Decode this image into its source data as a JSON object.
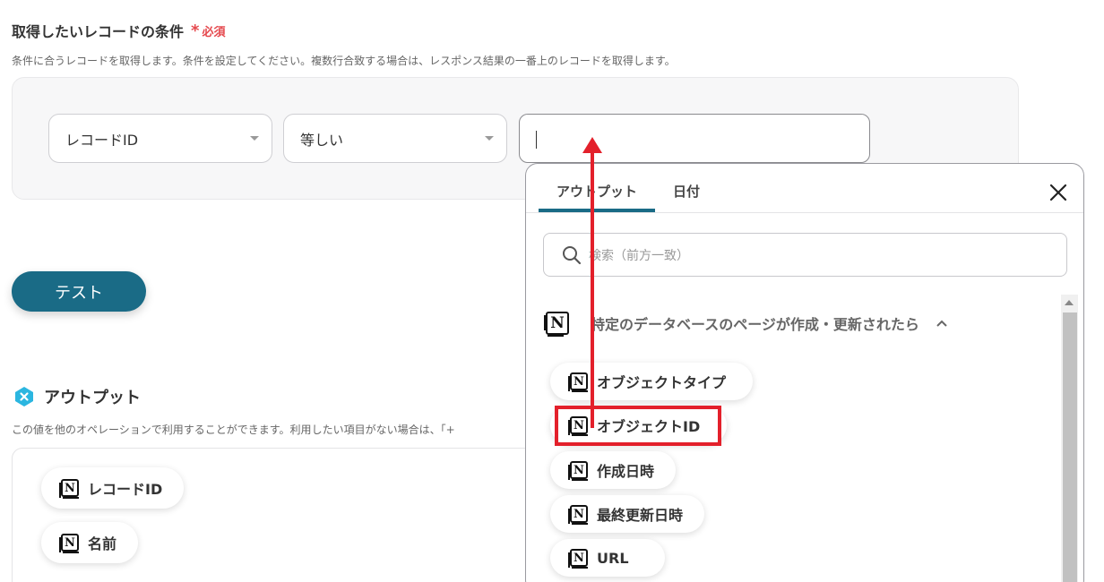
{
  "condition": {
    "title": "取得したいレコードの条件",
    "required_mark": "*",
    "required_label": "必須",
    "description": "条件に合うレコードを取得します。条件を設定してください。複数行合致する場合は、レスポンス結果の一番上のレコードを取得します。",
    "field_select": "レコードID",
    "operator_select": "等しい",
    "value_input": ""
  },
  "test_button": "テスト",
  "output": {
    "title": "アウトプット",
    "description": "この値を他のオペレーションで利用することができます。利用したい項目がない場合は、「+",
    "chips": [
      "レコードID",
      "名前"
    ]
  },
  "popup": {
    "tabs": [
      "アウトプット",
      "日付"
    ],
    "active_tab": "アウトプット",
    "search_placeholder": "検索（前方一致）",
    "group_title": "特定のデータベースのページが作成・更新されたら",
    "items": [
      "オブジェクトタイプ",
      "オブジェクトID",
      "作成日時",
      "最終更新日時",
      "URL"
    ],
    "highlighted_item": "オブジェクトID"
  },
  "icons": {
    "notion": "notion-icon",
    "output_logo": "yoom-logo-icon",
    "close": "close-icon",
    "search": "search-icon",
    "collapse": "chevron-up-icon"
  },
  "colors": {
    "accent": "#1a6b86",
    "annotation": "#e3202b",
    "required": "#e5484d"
  }
}
